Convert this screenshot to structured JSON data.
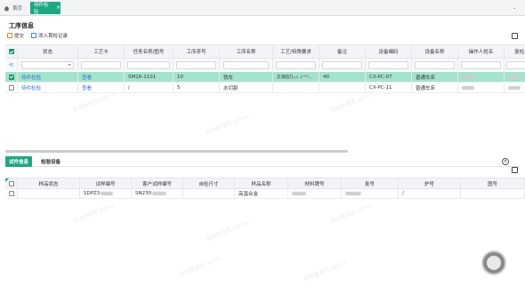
{
  "tabs": {
    "home_label": "首页",
    "active_label": "待件检验",
    "close_glyph": "×",
    "collapse_glyph": "⌄"
  },
  "process_info": {
    "title": "工序信息",
    "toolbar": {
      "submit_label": "提交",
      "add_record_label": "添入首检记录"
    },
    "columns": [
      "状态",
      "工艺卡",
      "任务名称/图号",
      "工序序号",
      "工序名称",
      "工艺/特殊要求",
      "备注",
      "设备编码",
      "设备名称",
      "操作人姓名",
      "复检人"
    ],
    "rows": [
      {
        "selected": true,
        "checked": true,
        "status": "待件检验",
        "card": "查看",
        "task": "SM16-1101",
        "seq": "10",
        "name": "铣车",
        "req": "实测圆刀ᵤₖ(..)⁺⁰·⁰...",
        "remark": "40",
        "equip_code": "CX-PC-07",
        "equip_name": "普通车床"
      },
      {
        "selected": false,
        "checked": false,
        "status": "待件检验",
        "card": "查看",
        "task": "/",
        "seq": "5",
        "name": "水切割",
        "req": "",
        "remark": "",
        "equip_code": "CX-PC-11",
        "equip_name": "普通车床"
      }
    ]
  },
  "lower": {
    "tabs": [
      "试件信息",
      "检验设备"
    ],
    "close_glyph": "×",
    "columns": [
      "样品状态",
      "试样编号",
      "客户试样编号",
      "自检尺寸",
      "样品名称",
      "材料牌号",
      "批号",
      "炉号",
      "图号"
    ],
    "row": {
      "sample_no": "SDPZ3",
      "cust_no": "SN230",
      "name": "高温合金",
      "furnace": "/"
    }
  },
  "watermark_text": "系统管理员 admin",
  "colors": {
    "accent": "#1fa784",
    "selected_row": "#a4e3cc",
    "link": "#2f6fd6"
  }
}
